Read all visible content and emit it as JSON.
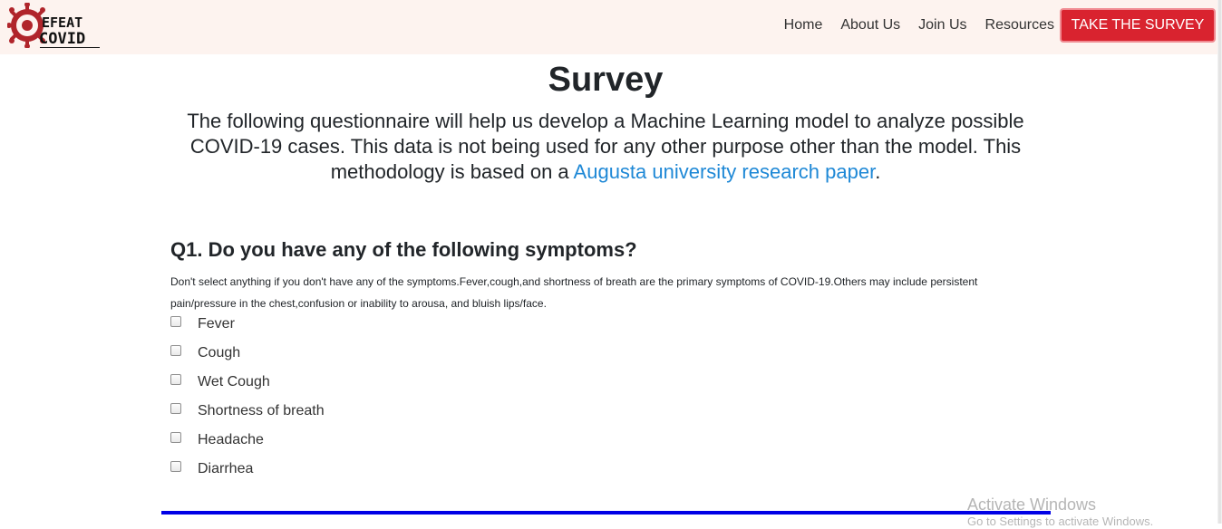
{
  "brand": {
    "line1": "EFEAT",
    "line2": "COVID"
  },
  "nav": {
    "links": [
      "Home",
      "About Us",
      "Join Us",
      "Resources"
    ],
    "cta_label": "TAKE THE SURVEY"
  },
  "page": {
    "title": "Survey",
    "intro_text": "The following questionnaire will help us develop a Machine Learning model to analyze possible COVID-19 cases. This data is not being used for any other purpose other than the model. This methodology is based on a ",
    "intro_link": "Augusta university research paper",
    "intro_end": "."
  },
  "question1": {
    "heading": "Q1. Do you have any of the following symptoms?",
    "note": "Don't select anything if you don't have any of the symptoms.Fever,cough,and shortness of breath are the primary symptoms of COVID-19.Others may include persistent pain/pressure in the chest,confusion or inability to arousa, and bluish lips/face.",
    "options": [
      "Fever",
      "Cough",
      "Wet Cough",
      "Shortness of breath",
      "Headache",
      "Diarrhea"
    ],
    "checked": [
      false,
      false,
      false,
      false,
      false,
      false
    ]
  },
  "watermark": {
    "title": "Activate Windows",
    "subtitle": "Go to Settings to activate Windows."
  },
  "colors": {
    "navbar_bg": "#fdf3ef",
    "cta_bg": "#d9232f",
    "link": "#1e88d6",
    "rule": "#0000e6",
    "logo_red": "#b0252b"
  },
  "icons": {
    "logo": "virus-gear-icon",
    "checkbox": "checkbox-unchecked"
  }
}
